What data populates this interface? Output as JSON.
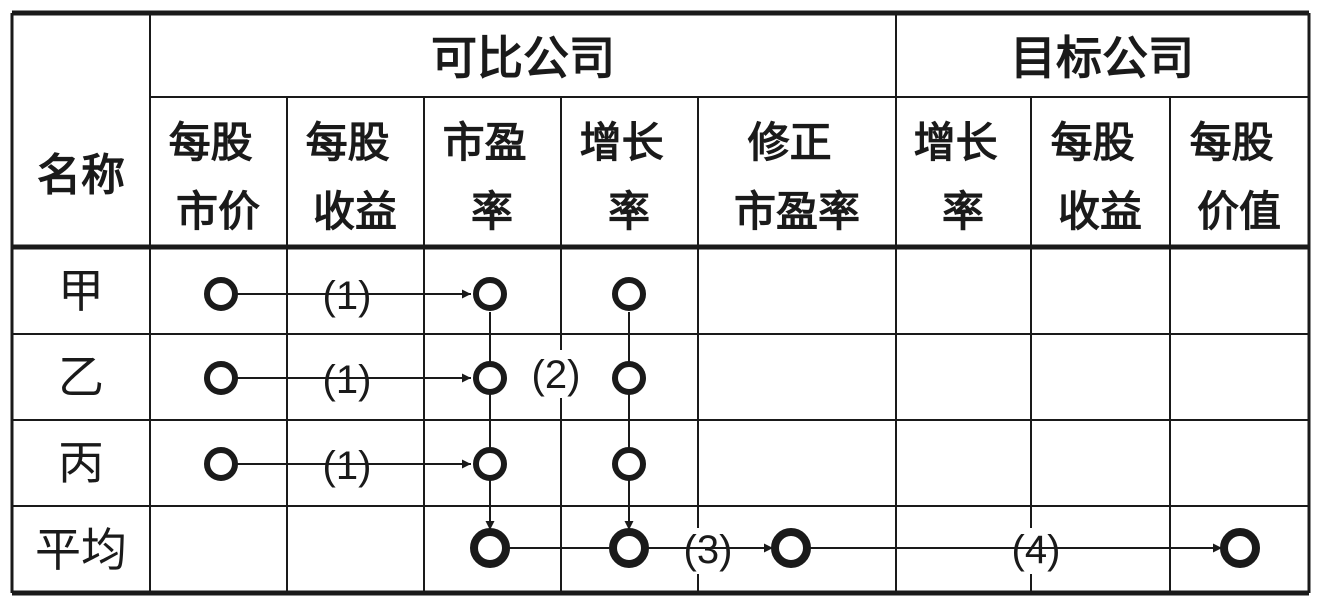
{
  "group_headers": {
    "comparable": "可比公司",
    "target": "目标公司"
  },
  "columns": {
    "name": "名称",
    "comparable": [
      [
        "每股",
        "市价"
      ],
      [
        "每股",
        "收益"
      ],
      [
        "市盈",
        "率"
      ],
      [
        "增长",
        "率"
      ],
      [
        "修正",
        "市盈率"
      ]
    ],
    "target": [
      [
        "增长",
        "率"
      ],
      [
        "每股",
        "收益"
      ],
      [
        "每股",
        "价值"
      ]
    ]
  },
  "rows": [
    "甲",
    "乙",
    "丙",
    "平均"
  ],
  "steps": {
    "step1": "(1)",
    "step2": "(2)",
    "step3": "(3)",
    "step4": "(4)"
  }
}
